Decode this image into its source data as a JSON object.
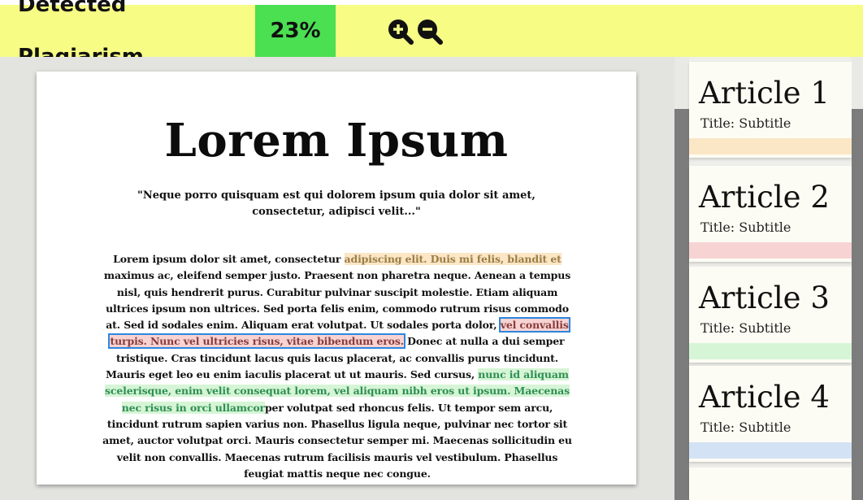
{
  "header": {
    "label": "Detected Plagiarism",
    "percent": "23%",
    "zoom_in_icon": "zoom-in-icon",
    "zoom_out_icon": "zoom-out-icon"
  },
  "document": {
    "title": "Lorem Ipsum",
    "quote": "\"Neque porro quisquam est qui dolorem ipsum quia dolor sit amet, consectetur, adipisci velit...\"",
    "body": {
      "t1": "Lorem ipsum dolor sit amet, consectetur ",
      "h1": "adipiscing elit. Duis mi felis, blandit et",
      "t2": " maximus ac, eleifend semper justo. Praesent non pharetra neque. Aenean a tempus nisl, quis hendrerit purus. Curabitur pulvinar suscipit molestie. Etiam aliquam ultrices ipsum non ultrices. Sed porta felis enim, commodo rutrum risus commodo at. Sed id sodales enim. Aliquam erat volutpat. Ut sodales porta dolor, ",
      "h2": "vel convallis turpis. Nunc vel ultricies risus, vitae bibendum eros.",
      "t3": " Donec at nulla a dui semper tristique. Cras tincidunt lacus quis lacus placerat, ac convallis purus tincidunt. Mauris eget leo eu enim iaculis placerat ut ut mauris. Sed cursus, ",
      "h3": "nunc id aliquam scelerisque, enim velit consequat lorem, vel aliquam nibh eros ut ipsum. Maecenas nec risus in orci ullamcor",
      "t4": "per volutpat sed rhoncus felis. Ut tempor sem arcu, tincidunt rutrum sapien varius non. Phasellus ligula neque, pulvinar nec tortor sit amet, auctor volutpat orci. Mauris consectetur semper mi. Maecenas sollicitudin eu velit non convallis. Maecenas rutrum facilisis mauris vel vestibulum. Phasellus feugiat mattis neque nec congue."
    }
  },
  "sidebar": {
    "articles": [
      {
        "title": "Article 1",
        "subtitle": "Title: Subtitle",
        "color": "#fbe6c6"
      },
      {
        "title": "Article 2",
        "subtitle": "Title: Subtitle",
        "color": "#f7d3d3"
      },
      {
        "title": "Article 3",
        "subtitle": "Title: Subtitle",
        "color": "#d6f5d6"
      },
      {
        "title": "Article 4",
        "subtitle": "Title: Subtitle",
        "color": "#d3e3f5"
      }
    ]
  },
  "colors": {
    "header_bg": "#f6fc84",
    "percent_bg": "#4bdf52",
    "match_orange": "#fbe6c6",
    "match_red": "#f7d3d3",
    "match_green": "#d6f5d6",
    "match_blue": "#d3e3f5",
    "selection_outline": "#2e86de"
  }
}
